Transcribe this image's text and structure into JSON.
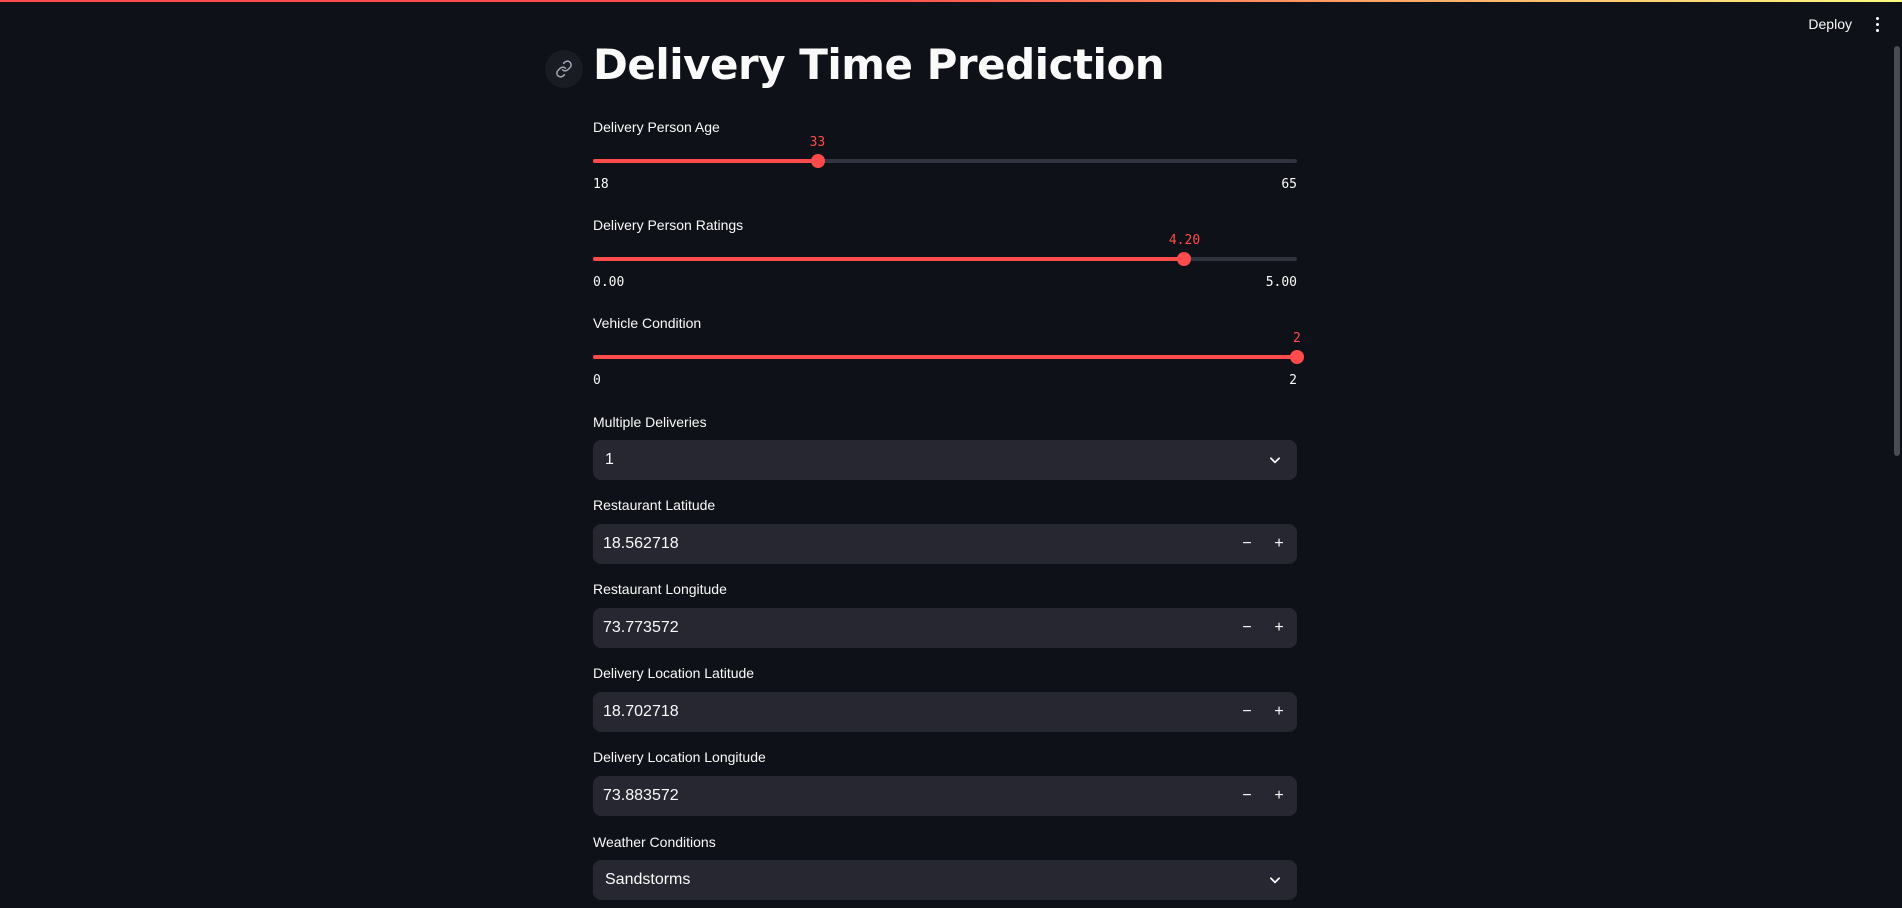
{
  "header": {
    "deploy_label": "Deploy",
    "menu_icon": "kebab-menu-icon"
  },
  "page": {
    "title": "Delivery Time Prediction",
    "anchor_icon": "link-icon"
  },
  "colors": {
    "accent": "#ff4b4b",
    "background": "#0e1117",
    "input_background": "#262730",
    "track": "#31333f",
    "text": "#fafafa"
  },
  "sliders": [
    {
      "label": "Delivery Person Age",
      "value": "33",
      "min": "18",
      "max": "65",
      "fraction": 0.319
    },
    {
      "label": "Delivery Person Ratings",
      "value": "4.20",
      "min": "0.00",
      "max": "5.00",
      "fraction": 0.84
    },
    {
      "label": "Vehicle Condition",
      "value": "2",
      "min": "0",
      "max": "2",
      "fraction": 1.0
    }
  ],
  "multiple_deliveries": {
    "label": "Multiple Deliveries",
    "value": "1"
  },
  "number_inputs": [
    {
      "label": "Restaurant Latitude",
      "value": "18.562718"
    },
    {
      "label": "Restaurant Longitude",
      "value": "73.773572"
    },
    {
      "label": "Delivery Location Latitude",
      "value": "18.702718"
    },
    {
      "label": "Delivery Location Longitude",
      "value": "73.883572"
    }
  ],
  "weather": {
    "label": "Weather Conditions",
    "value": "Sandstorms"
  },
  "stepper": {
    "minus": "−",
    "plus": "+"
  }
}
